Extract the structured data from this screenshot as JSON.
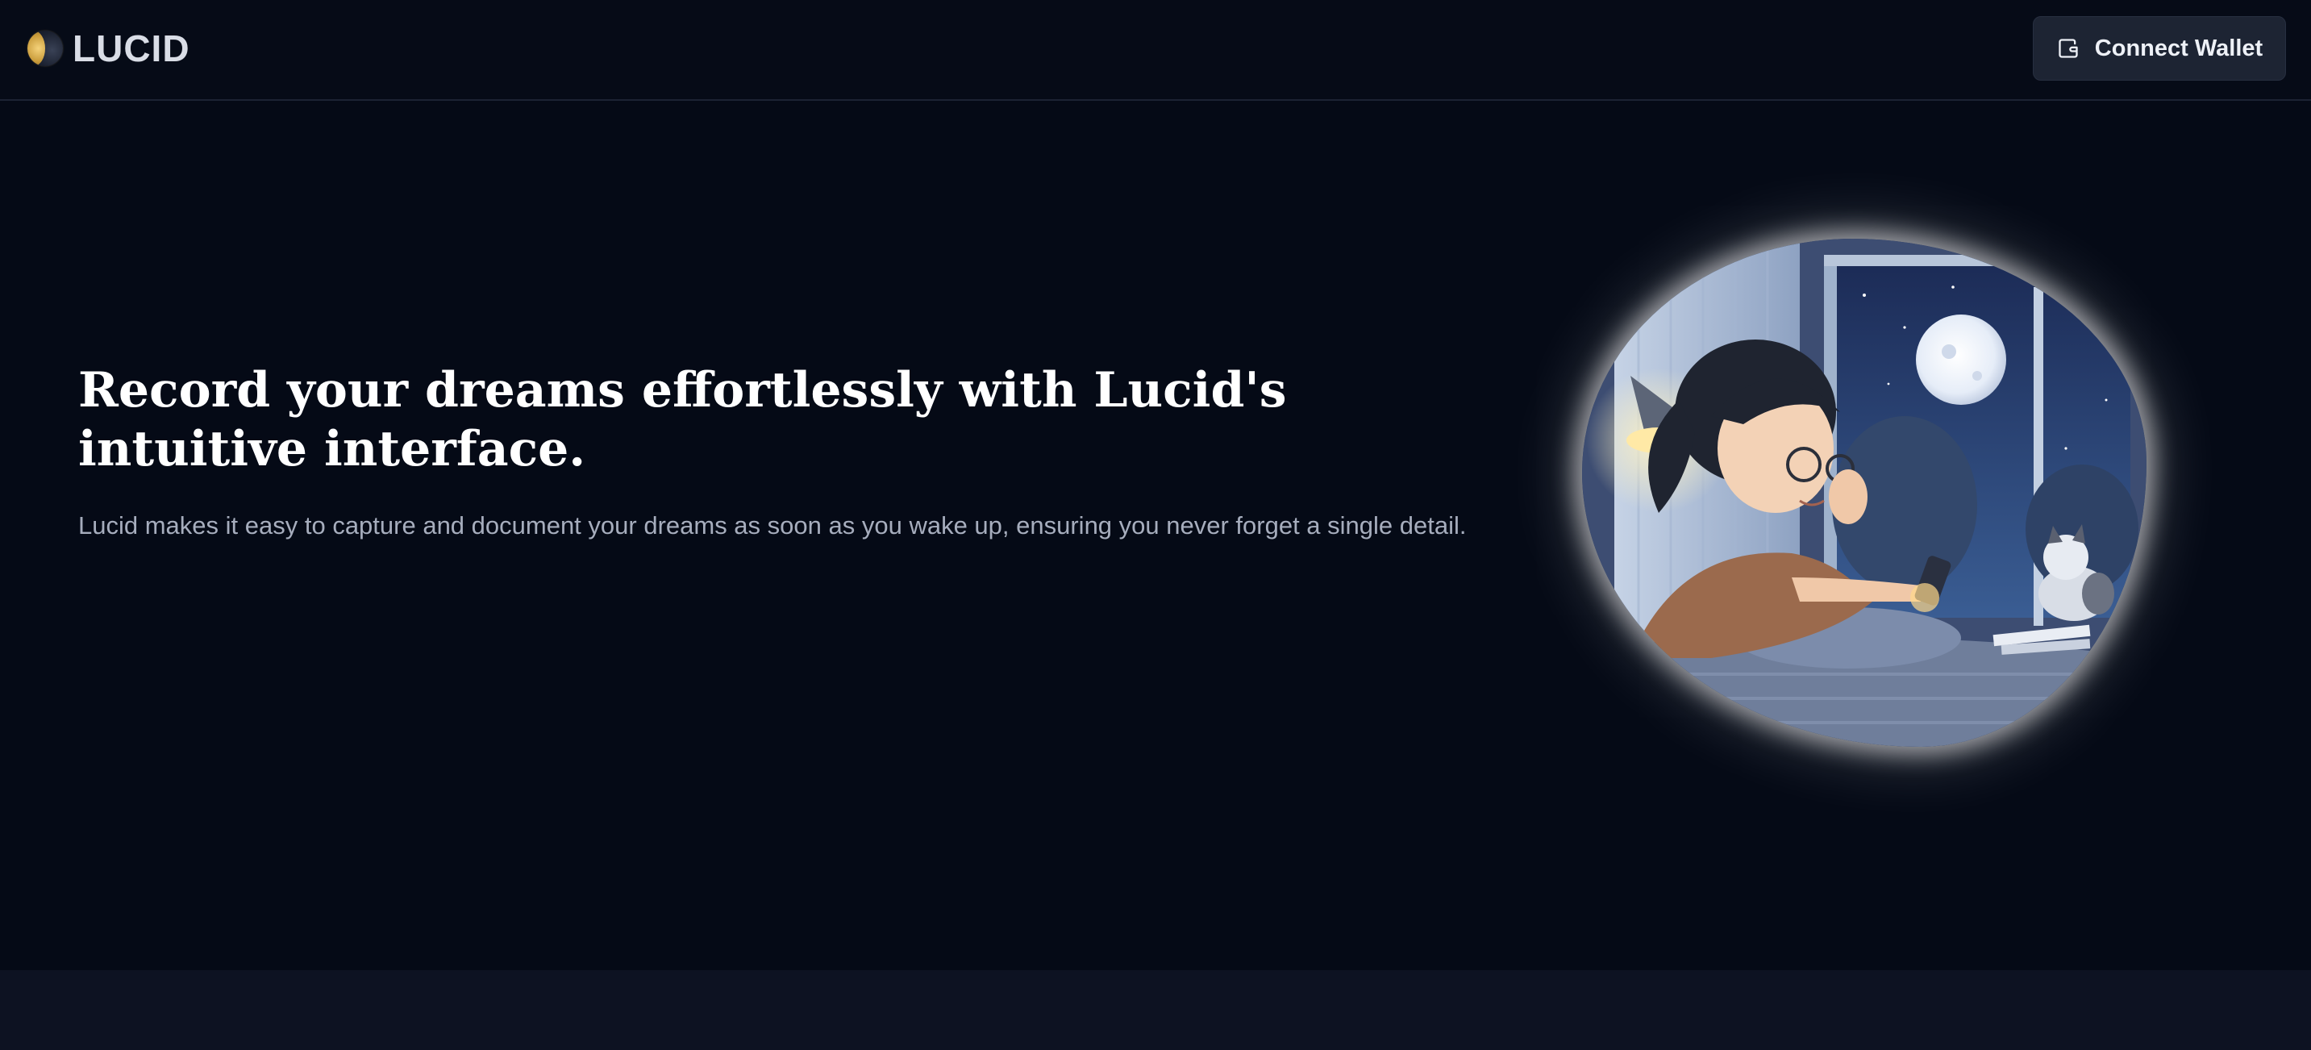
{
  "header": {
    "logo_text": "LUCID",
    "connect_wallet_label": "Connect Wallet"
  },
  "hero": {
    "title": "Record your dreams effortlessly with Lucid's intuitive interface.",
    "description": "Lucid makes it easy to capture and document your dreams as soon as you wake up, ensuring you never forget a single detail."
  },
  "icons": {
    "logo": "moon-logo-icon",
    "wallet": "wallet-icon"
  },
  "colors": {
    "background": "#050a16",
    "button_bg": "#1d2433",
    "footer_band": "#0d1222"
  }
}
